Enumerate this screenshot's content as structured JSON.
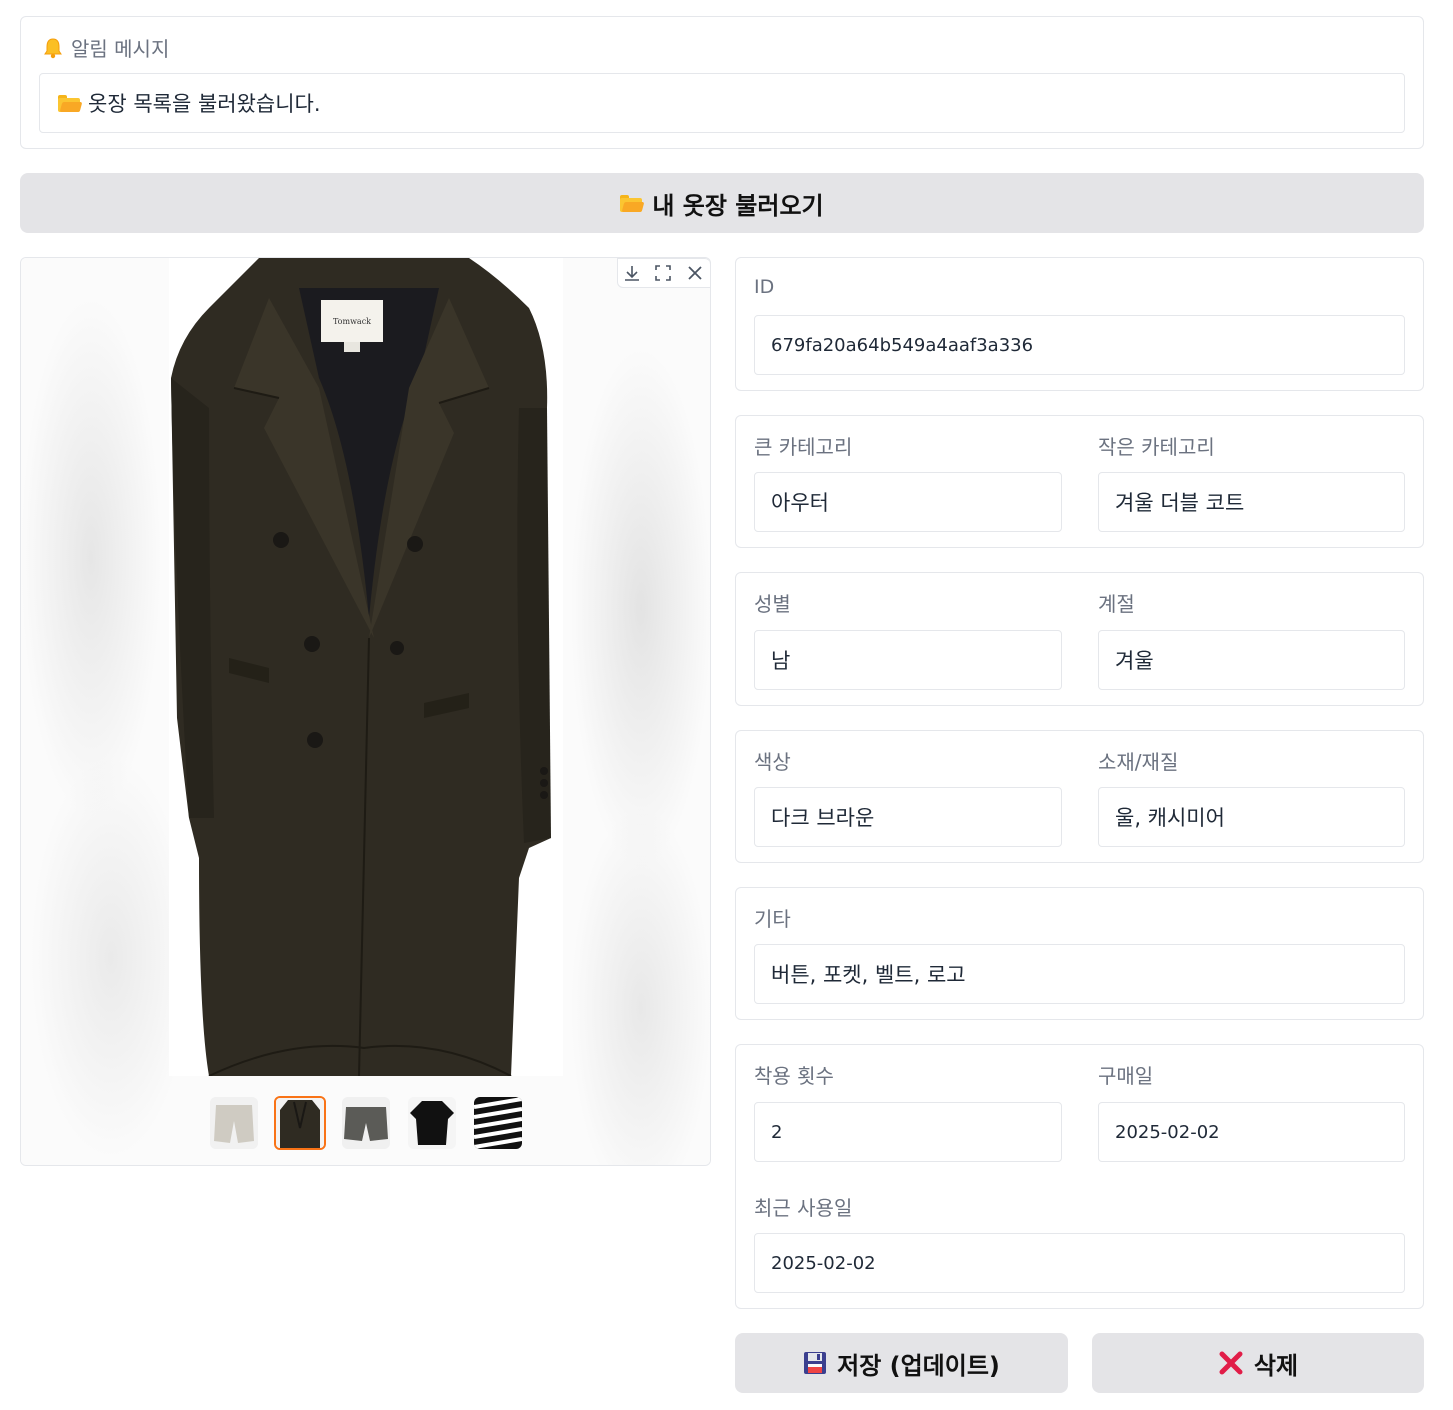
{
  "alert": {
    "title": "알림 메시지",
    "message": "옷장 목록을 불러왔습니다."
  },
  "load_button": {
    "label": "내 옷장 불러오기"
  },
  "gallery": {
    "thumbnails": [
      "thumbnail-shorts-beige",
      "thumbnail-coat-brown",
      "thumbnail-shorts-gray",
      "thumbnail-shirt-black",
      "thumbnail-zebra-top"
    ],
    "selected_index": 1
  },
  "form": {
    "id": {
      "label": "ID",
      "value": "679fa20a64b549a4aaf3a336"
    },
    "main_category": {
      "label": "큰 카테고리",
      "value": "아우터"
    },
    "sub_category": {
      "label": "작은 카테고리",
      "value": "겨울 더블 코트"
    },
    "gender": {
      "label": "성별",
      "value": "남"
    },
    "season": {
      "label": "계절",
      "value": "겨울"
    },
    "color": {
      "label": "색상",
      "value": "다크 브라운"
    },
    "material": {
      "label": "소재/재질",
      "value": "울, 캐시미어"
    },
    "etc": {
      "label": "기타",
      "value": "버튼, 포켓, 벨트, 로고"
    },
    "wear_count": {
      "label": "착용 횟수",
      "value": "2"
    },
    "purchase_date": {
      "label": "구매일",
      "value": "2025-02-02"
    },
    "last_used": {
      "label": "최근 사용일",
      "value": "2025-02-02"
    }
  },
  "actions": {
    "save_label": "저장 (업데이트)",
    "delete_label": "삭제"
  },
  "colors": {
    "button_bg": "#e4e4e7",
    "border": "#e5e7eb",
    "thumb_active": "#f97316",
    "delete_x": "#e11d48"
  }
}
